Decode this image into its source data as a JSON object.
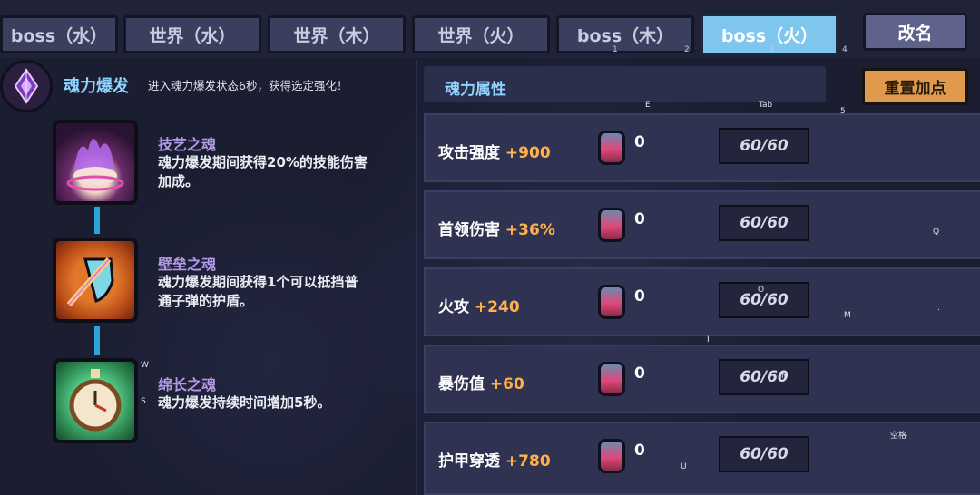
{
  "tabs": [
    {
      "label": "boss（水）",
      "num": ""
    },
    {
      "label": "世界（水）",
      "num": ""
    },
    {
      "label": "世界（木）",
      "num": ""
    },
    {
      "label": "世界（火）",
      "num": ""
    },
    {
      "label": "boss（木）",
      "num": "1"
    },
    {
      "label": "boss（火）",
      "num": "3",
      "active": true
    }
  ],
  "tab_extra_nums": [
    "2",
    "4"
  ],
  "rename_label": "改名",
  "soul_burst": {
    "title": "魂力爆发",
    "description": "进入魂力爆发状态6秒，获得选定强化！"
  },
  "souls": [
    {
      "name": "技艺之魂",
      "desc_line1": "魂力爆发期间获得20%的技能伤害",
      "desc_line2": "加成。",
      "icon": "purple-flame-gem-icon"
    },
    {
      "name": "壁垒之魂",
      "desc_line1": "魂力爆发期间获得1个可以抵挡普",
      "desc_line2": "通子弹的护盾。",
      "icon": "shield-sword-icon"
    },
    {
      "name": "绵长之魂",
      "desc_line1": "魂力爆发持续时间增加5秒。",
      "desc_line2": "",
      "icon": "stopwatch-icon"
    }
  ],
  "attributes": {
    "header": "魂力属性",
    "reset_label": "重置加点",
    "rows": [
      {
        "name": "攻击强度",
        "bonus": "+900",
        "gem_count": "0",
        "progress": "60/60"
      },
      {
        "name": "首领伤害",
        "bonus": "+36%",
        "gem_count": "0",
        "progress": "60/60"
      },
      {
        "name": "火攻",
        "bonus": "+240",
        "gem_count": "0",
        "progress": "60/60"
      },
      {
        "name": "暴伤值",
        "bonus": "+60",
        "gem_count": "0",
        "progress": "60/60"
      },
      {
        "name": "护甲穿透",
        "bonus": "+780",
        "gem_count": "0",
        "progress": "60/60"
      }
    ]
  },
  "key_hints": {
    "e": "E",
    "tab": "Tab",
    "five": "5",
    "q": "Q",
    "o": "O",
    "m": "M",
    "dot": ".",
    "i": "I",
    "n": "N",
    "w": "W",
    "s": "S",
    "space": "空格",
    "u": "U"
  },
  "colors": {
    "accent_blue": "#8fd3ff",
    "bonus_orange": "#ffb04a",
    "active_tab": "#7fc6ee",
    "reset_button": "#e09a4e"
  }
}
